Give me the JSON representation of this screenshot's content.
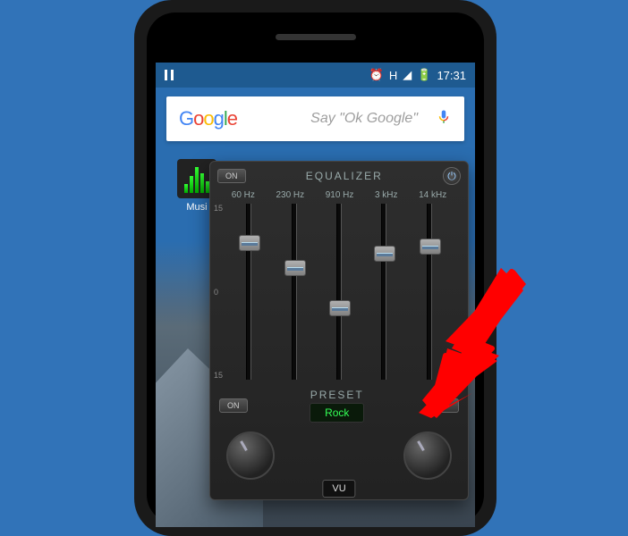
{
  "status": {
    "time": "17:31",
    "network": "H",
    "alarm": true,
    "battery_charging": true
  },
  "search": {
    "logo_parts": [
      "G",
      "o",
      "o",
      "g",
      "l",
      "e"
    ],
    "placeholder": "Say \"Ok Google\""
  },
  "home_app": {
    "label": "Musi"
  },
  "equalizer": {
    "title": "EQUALIZER",
    "on_label": "ON",
    "off_label": "OFF",
    "db_scale": [
      "15",
      "0",
      "15"
    ],
    "bands": [
      {
        "freq": "60 Hz",
        "pos": 18
      },
      {
        "freq": "230 Hz",
        "pos": 32
      },
      {
        "freq": "910 Hz",
        "pos": 55
      },
      {
        "freq": "3 kHz",
        "pos": 24
      },
      {
        "freq": "14 kHz",
        "pos": 20
      }
    ],
    "preset_label": "PRESET",
    "preset_value": "Rock",
    "vu_label": "VU"
  }
}
